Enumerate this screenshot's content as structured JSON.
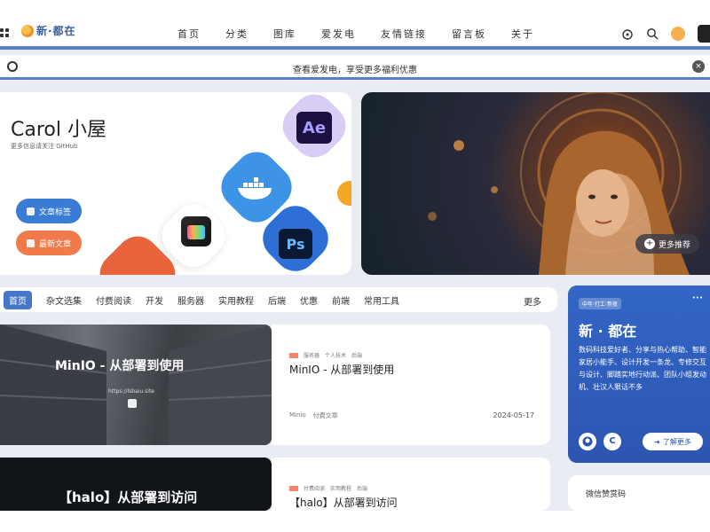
{
  "header": {
    "logo_text": "新·都在",
    "nav": [
      "首页",
      "分类",
      "图库",
      "爱发电",
      "友情链接",
      "留言板",
      "关于"
    ]
  },
  "notice": {
    "text": "查看爱发电，享受更多福利优惠",
    "close": "×"
  },
  "hero": {
    "title": "Carol 小屋",
    "subtitle": "更多信息请关注 GitHub",
    "btn_tags": "文章标签",
    "btn_latest": "最新文章",
    "more": "更多推荐",
    "app_labels": {
      "ae": "Ae",
      "ps": "Ps"
    }
  },
  "tabs": {
    "items": [
      "首页",
      "杂文选集",
      "付费阅读",
      "开发",
      "服务器",
      "实用教程",
      "后端",
      "优惠",
      "前端",
      "常用工具"
    ],
    "more": "更多"
  },
  "posts": [
    {
      "image_title": "MinIO - 从部署到使用",
      "image_url": "https://lsbaiu.site",
      "tags": [
        "服务器",
        "个人技术",
        "后端"
      ],
      "title": "MinIO - 从部署到使用",
      "author": "Minio",
      "category": "付费文章",
      "date": "2024-05-17"
    },
    {
      "image_title": "【halo】从部署到访问",
      "tags": [
        "付费阅读",
        "实用教程",
        "后端"
      ],
      "title": "【halo】从部署到访问"
    }
  ],
  "profile": {
    "tag": "中年·打工·熬夜",
    "more": "•••",
    "name": "新 · 都在",
    "desc": "数码科技爱好者、分享与热心帮助、智能家居小能手、设计开发一条龙、专修交互与设计、脚踏实地行动派、团队小组发动机、壮汉人狠话不多",
    "learn_more": "了解更多",
    "c_label": "C"
  },
  "reward": {
    "title": "微信赞赏码"
  }
}
